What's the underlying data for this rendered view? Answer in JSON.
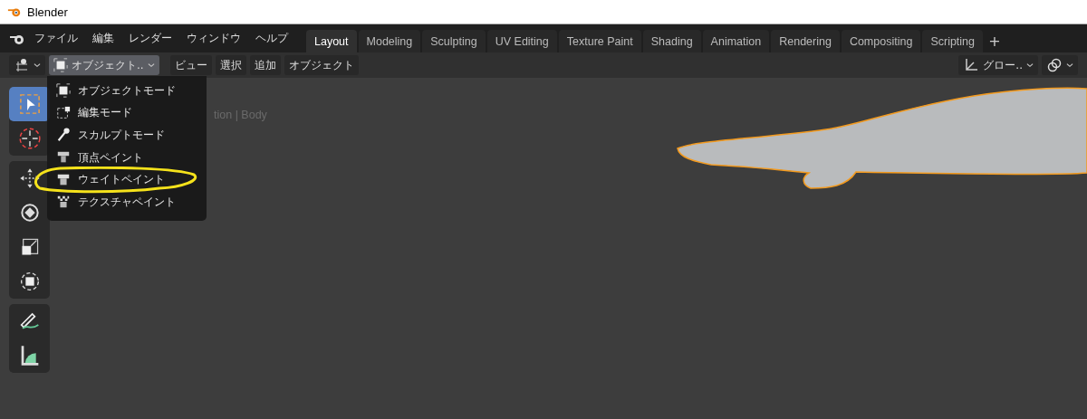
{
  "window": {
    "title": "Blender"
  },
  "menubar": [
    "ファイル",
    "編集",
    "レンダー",
    "ウィンドウ",
    "ヘルプ"
  ],
  "workspaces": [
    {
      "label": "Layout",
      "selected": true
    },
    {
      "label": "Modeling",
      "selected": false
    },
    {
      "label": "Sculpting",
      "selected": false
    },
    {
      "label": "UV Editing",
      "selected": false
    },
    {
      "label": "Texture Paint",
      "selected": false
    },
    {
      "label": "Shading",
      "selected": false
    },
    {
      "label": "Animation",
      "selected": false
    },
    {
      "label": "Rendering",
      "selected": false
    },
    {
      "label": "Compositing",
      "selected": false
    },
    {
      "label": "Scripting",
      "selected": false
    }
  ],
  "add_workspace": "+",
  "header": {
    "mode_dropdown": {
      "label": "オブジェクト..",
      "expanded": true
    },
    "menus": [
      "ビュー",
      "選択",
      "追加",
      "オブジェクト"
    ],
    "orientation": "グロー.."
  },
  "mode_menu": [
    {
      "kind": "object",
      "label": "オブジェクトモード"
    },
    {
      "kind": "edit",
      "label": "編集モード"
    },
    {
      "kind": "sculpt",
      "label": "スカルプトモード"
    },
    {
      "kind": "vertex",
      "label": "頂点ペイント"
    },
    {
      "kind": "weight",
      "label": "ウェイトペイント",
      "highlighted": true
    },
    {
      "kind": "texture",
      "label": "テクスチャペイント"
    }
  ],
  "viewport_info": "tion | Body",
  "tools": [
    {
      "kind": "select",
      "selected": true
    },
    {
      "kind": "cursor",
      "selected": false
    },
    {
      "kind": "move",
      "selected": false
    },
    {
      "kind": "rotate",
      "selected": false
    },
    {
      "kind": "scale",
      "selected": false
    },
    {
      "kind": "transform",
      "selected": false
    },
    {
      "kind": "annotate",
      "selected": false
    },
    {
      "kind": "measure",
      "selected": false
    }
  ]
}
